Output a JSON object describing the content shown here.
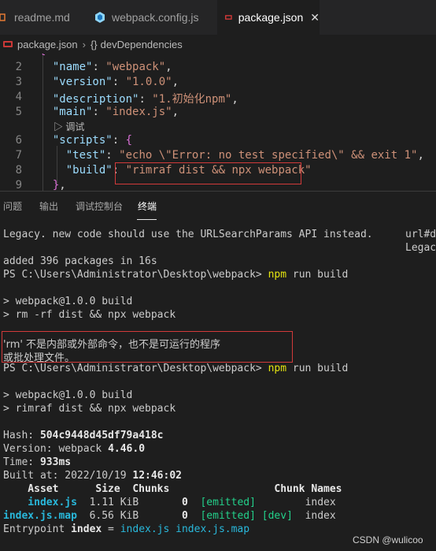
{
  "tabs": [
    {
      "label": "readme.md",
      "active": false
    },
    {
      "label": "webpack.config.js",
      "active": false
    },
    {
      "label": "package.json",
      "active": true
    }
  ],
  "breadcrumb": {
    "file": "package.json",
    "symbol_glyph": "{}",
    "symbol": "devDependencies"
  },
  "editor": {
    "line_numbers": [
      "2",
      "3",
      "4",
      "5",
      "6",
      "7",
      "8",
      "9"
    ],
    "fields": {
      "name_key": "\"name\"",
      "name_val": "\"webpack\"",
      "version_key": "\"version\"",
      "version_val": "\"1.0.0\"",
      "description_key": "\"description\"",
      "description_val": "\"1.初始化npm\"",
      "main_key": "\"main\"",
      "main_val": "\"index.js\"",
      "debug_lens": "▷ 调试",
      "scripts_key": "\"scripts\"",
      "test_key": "\"test\"",
      "test_val": "\"echo \\\"Error: no test specified\\\" && exit 1\"",
      "build_key": "\"build\"",
      "build_val": "\"rimraf dist && npx webpack\""
    }
  },
  "panel_tabs": [
    {
      "label": "问题",
      "active": false
    },
    {
      "label": "输出",
      "active": false
    },
    {
      "label": "调试控制台",
      "active": false
    },
    {
      "label": "终端",
      "active": true
    }
  ],
  "terminal": {
    "legacy_line": "Legacy. new code should use the URLSearchParams API instead.",
    "right_col": [
      "url#de",
      "Legacy"
    ],
    "added_line": "added 396 packages in 16s",
    "prompt": "PS C:\\Users\\Administrator\\Desktop\\webpack>",
    "cmd": "npm",
    "cmd_args": "run build",
    "run1_pkg": "> webpack@1.0.0 build",
    "run1_script": "> rm -rf dist && npx webpack",
    "err_line1": "'rm' 不是内部或外部命令，也不是可运行的程序",
    "err_line2": "或批处理文件。",
    "run2_pkg": "> webpack@1.0.0 build",
    "run2_script": "> rimraf dist && npx webpack",
    "hash_label": "Hash: ",
    "hash_value": "504c9448d45df79a418c",
    "version_label": "Version: webpack ",
    "version_value": "4.46.0",
    "time_label": "Time: ",
    "time_value": "933ms",
    "built_label": "Built at: 2022/10/19 ",
    "built_value": "12:46:02",
    "table_header": "    Asset      Size  Chunks                 Chunk Names",
    "rows": [
      {
        "asset": "    index.js",
        "size": "1.11 KiB",
        "chunk": "0",
        "emitted": "[emitted]",
        "dev": "",
        "names": "index"
      },
      {
        "asset": "index.js.map",
        "size": "6.56 KiB",
        "chunk": "0",
        "emitted": "[emitted]",
        "dev": "[dev]",
        "names": "index"
      }
    ],
    "entry_label": "Entrypoint ",
    "entry_name": "index",
    "entry_eq": " = ",
    "entry_files": "index.js index.js.map"
  },
  "watermark": "CSDN @wulicoo",
  "colors": {
    "editor_bg": "#1e1e1e",
    "key": "#9cdcfe",
    "string": "#ce9178",
    "highlight_box": "#d23a3a",
    "cmd": "#e5e510",
    "emitted": "#23d18b",
    "asset": "#29b8db"
  }
}
